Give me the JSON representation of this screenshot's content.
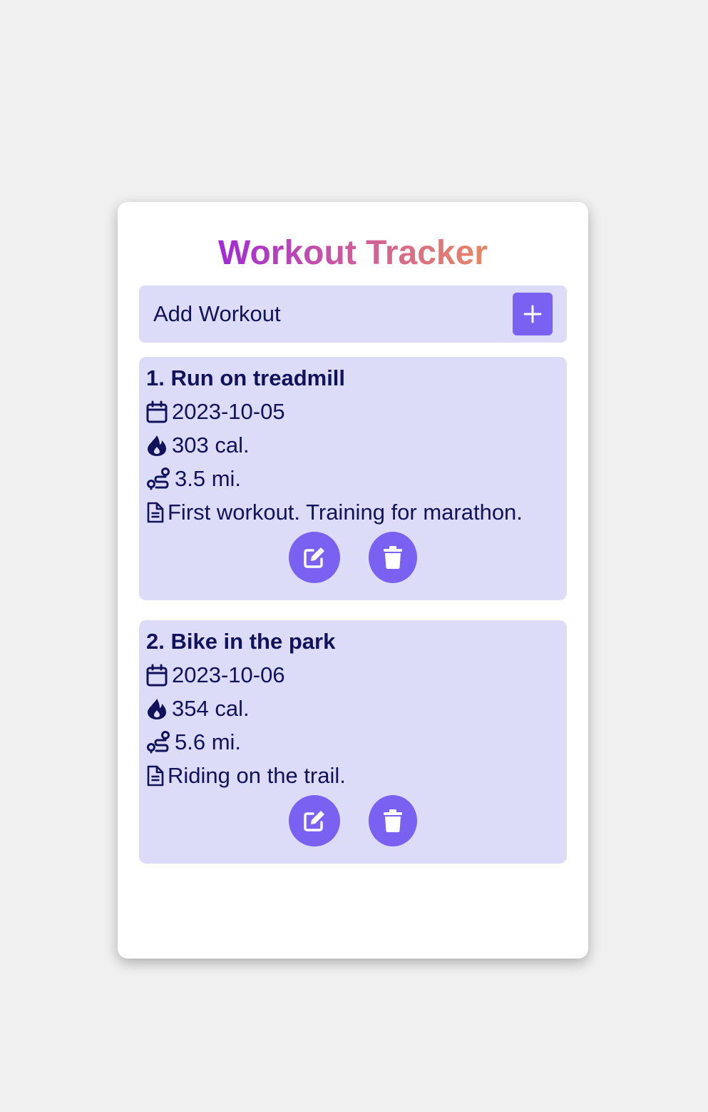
{
  "app": {
    "title": "Workout Tracker"
  },
  "add_bar": {
    "label": "Add Workout"
  },
  "workouts": [
    {
      "title": "1. Run on treadmill",
      "date": "2023-10-05",
      "calories": "303 cal.",
      "distance": "3.5 mi.",
      "note": "First workout. Training for marathon."
    },
    {
      "title": "2. Bike in the park",
      "date": "2023-10-06",
      "calories": "354 cal.",
      "distance": "5.6 mi.",
      "note": "Riding on the trail."
    }
  ],
  "icons": {
    "add": "plus-icon",
    "date": "calendar-icon",
    "calories": "flame-icon",
    "distance": "route-icon",
    "note": "document-icon",
    "edit": "edit-icon",
    "delete": "trash-icon"
  },
  "colors": {
    "background": "#f0f0f0",
    "card": "#ffffff",
    "panel": "#dcdcf8",
    "accent": "#7b61f2",
    "text": "#12125c",
    "title_gradient_start": "#a229d6",
    "title_gradient_end": "#e98662"
  }
}
